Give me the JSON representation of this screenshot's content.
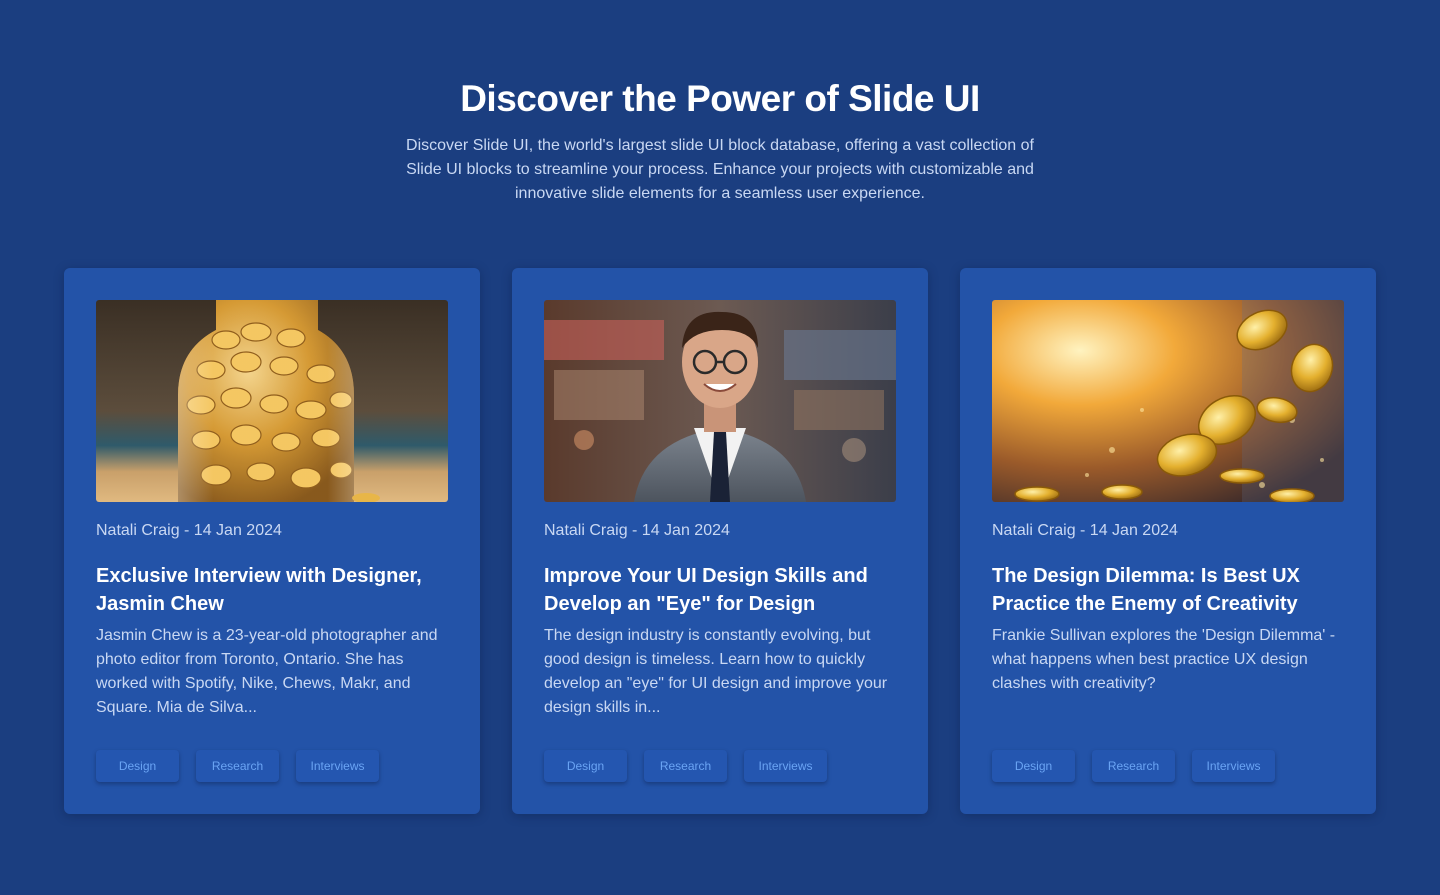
{
  "hero": {
    "title": "Discover the Power of Slide UI",
    "description": "Discover Slide UI, the world's largest slide UI block database, offering a vast collection of Slide UI blocks to streamline your process. Enhance your projects with customizable and innovative slide elements for a seamless user experience."
  },
  "colors": {
    "background": "#1b3e80",
    "card": "#2353a8",
    "tag_text": "#6aa4f4"
  },
  "cards": [
    {
      "image": "jar-of-gold-coins",
      "meta": "Natali Craig - 14 Jan 2024",
      "title": "Exclusive Interview with Designer, Jasmin Chew",
      "description": "Jasmin Chew is a 23-year-old photographer and photo editor from Toronto, Ontario. She has worked with Spotify, Nike, Chews, Makr, and Square. Mia de Silva...",
      "tags": [
        "Design",
        "Research",
        "Interviews"
      ]
    },
    {
      "image": "smiling-man-in-suit",
      "meta": "Natali Craig - 14 Jan 2024",
      "title": "Improve Your UI Design Skills and Develop an \"Eye\" for Design",
      "description": "The design industry is constantly evolving, but good design is timeless. Learn how to quickly develop an \"eye\" for UI design and improve your design skills in...",
      "tags": [
        "Design",
        "Research",
        "Interviews"
      ]
    },
    {
      "image": "falling-gold-coins",
      "meta": "Natali Craig - 14 Jan 2024",
      "title": "The Design Dilemma: Is Best UX Practice the Enemy of Creativity",
      "description": "Frankie Sullivan explores the 'Design Dilemma' - what happens when best practice UX design clashes with creativity?",
      "tags": [
        "Design",
        "Research",
        "Interviews"
      ]
    }
  ]
}
